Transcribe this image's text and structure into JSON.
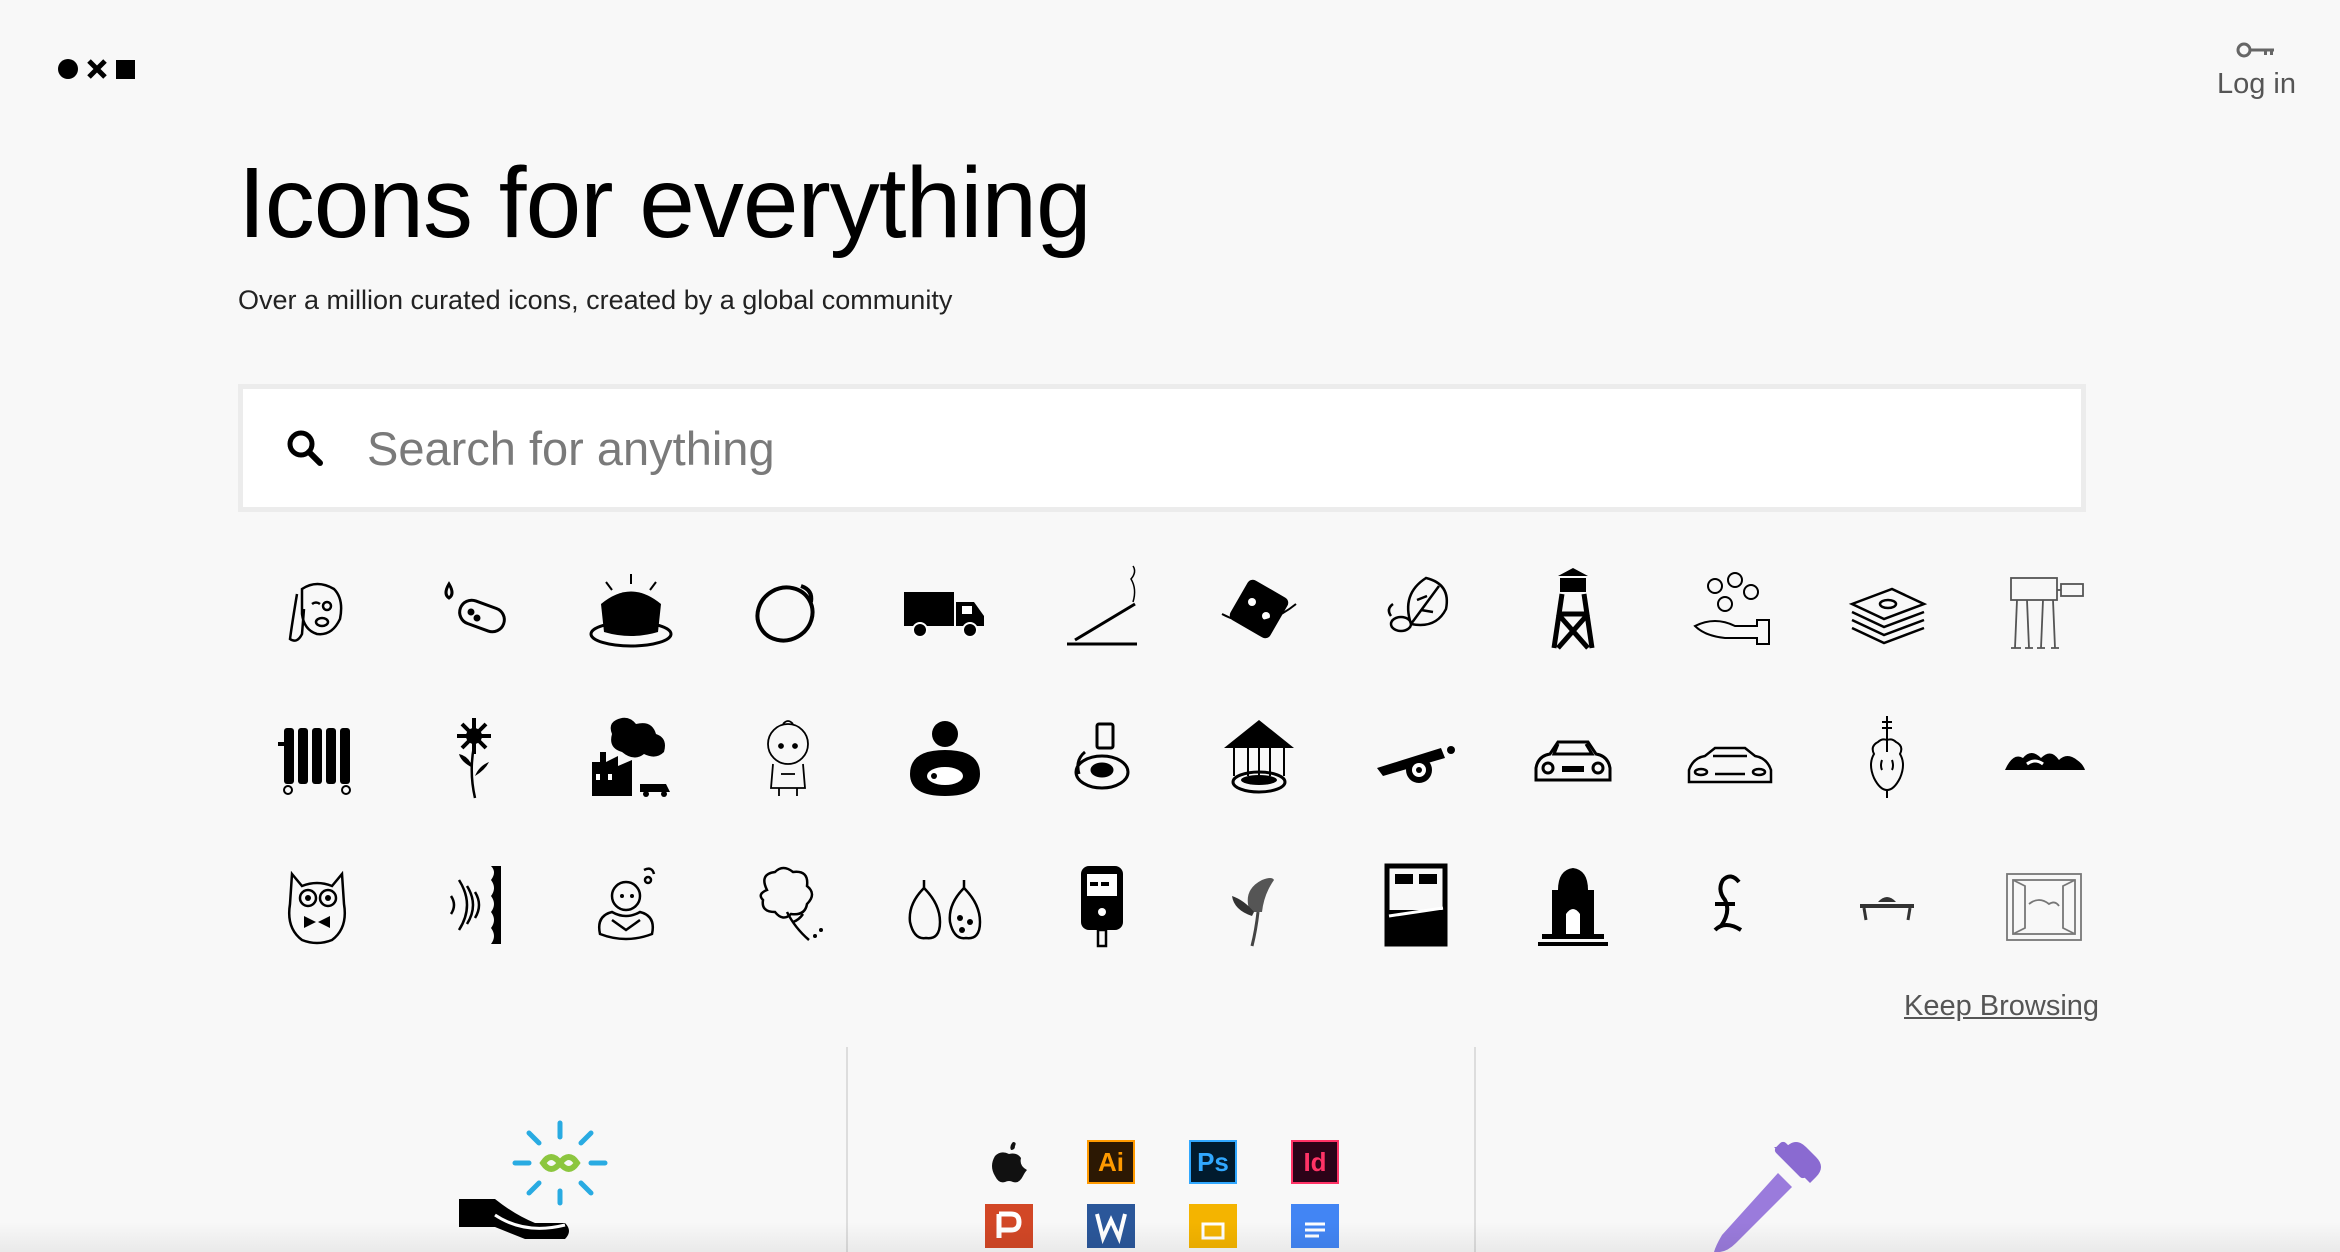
{
  "header": {
    "logo_icons": [
      "circle-icon",
      "x-icon",
      "square-icon"
    ],
    "login_label": "Log in",
    "login_icon": "key-icon"
  },
  "hero": {
    "title": "Icons for everything",
    "subtitle": "Over a million curated icons, created by a global community"
  },
  "search": {
    "placeholder": "Search for anything",
    "value": "",
    "icon": "search-icon"
  },
  "icon_grid": [
    [
      "dog-icon",
      "bandage-icon",
      "bundt-cake-icon",
      "fruit-icon",
      "delivery-truck-icon",
      "incense-stick-icon",
      "dice-icon",
      "leaf-icon",
      "watchtower-icon",
      "coins-hand-icon",
      "money-stack-icon",
      "at-at-walker-icon"
    ],
    [
      "radiator-icon",
      "sunflower-icon",
      "factory-pollution-icon",
      "baby-icon",
      "person-lifebuoy-icon",
      "toilet-paper-icon",
      "carousel-icon",
      "cannon-icon",
      "vintage-car-icon",
      "sports-car-icon",
      "cello-icon",
      "mountains-icon"
    ],
    [
      "owl-icon",
      "sound-wave-wall-icon",
      "child-reading-icon",
      "broccoli-icon",
      "fig-icon",
      "glucose-meter-icon",
      "calla-lily-icon",
      "bed-icon",
      "mosque-gate-icon",
      "pound-sign-icon",
      "table-food-icon",
      "window-icon"
    ]
  ],
  "keep_browsing_label": "Keep Browsing",
  "features": {
    "integrations": [
      "apple-icon",
      "illustrator-icon",
      "photoshop-icon",
      "indesign-icon",
      "powerpoint-icon",
      "word-icon",
      "slides-icon",
      "docs-icon"
    ],
    "integration_labels": [
      "Ai",
      "Ps",
      "Id"
    ],
    "colors": {
      "accent_blue": "#29abe2",
      "accent_green": "#8cc63f",
      "dropper_purple": "#8a6ad1"
    }
  }
}
